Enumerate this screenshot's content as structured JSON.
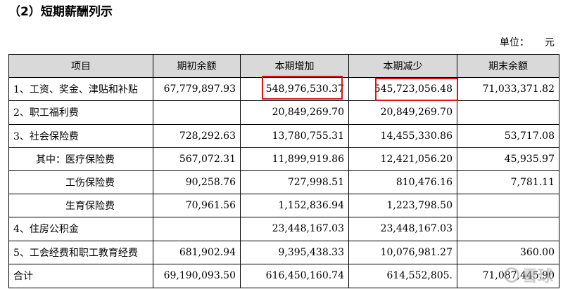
{
  "title": "（2）短期薪酬列示",
  "unit": {
    "label": "单位：",
    "value": "元"
  },
  "table": {
    "headers": [
      "项目",
      "期初余额",
      "本期增加",
      "本期减少",
      "期末余额"
    ],
    "rows": [
      [
        "1、工资、奖金、津贴和补贴",
        "67,779,897.93",
        "548,976,530.37",
        "545,723,056.48",
        "71,033,371.82"
      ],
      [
        "2、职工福利费",
        "",
        "20,849,269.70",
        "20,849,269.70",
        ""
      ],
      [
        "3、社会保险费",
        "728,292.63",
        "13,780,755.31",
        "14,455,330.86",
        "53,717.08"
      ],
      [
        "其中：医疗保险费",
        "567,072.31",
        "11,899,919.86",
        "12,421,056.20",
        "45,935.97"
      ],
      [
        "工伤保险费",
        "90,258.76",
        "727,998.51",
        "810,476.16",
        "7,781.11"
      ],
      [
        "生育保险费",
        "70,961.56",
        "1,152,836.94",
        "1,223,798.50",
        ""
      ],
      [
        "4、住房公积金",
        "",
        "23,448,167.03",
        "23,448,167.03",
        ""
      ],
      [
        "5、工会经费和职工教育经费",
        "681,902.94",
        "9,395,438.33",
        "10,076,981.27",
        "360.00"
      ]
    ],
    "total": [
      "合计",
      "69,190,093.50",
      "616,450,160.74",
      "614,552,805.",
      "71,087,445.90"
    ]
  },
  "watermark": "雪球"
}
